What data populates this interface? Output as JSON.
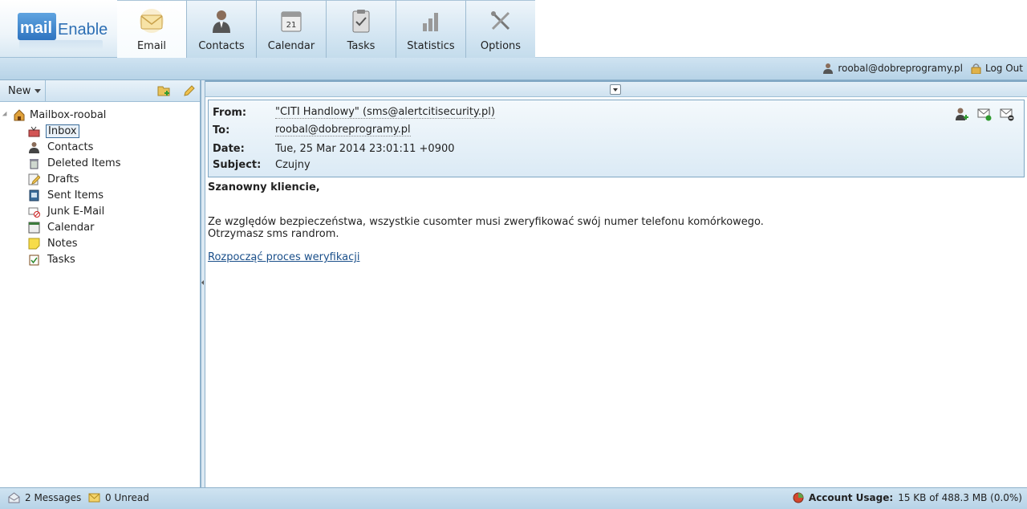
{
  "brand": {
    "logo_mail": "mail",
    "logo_enable": "Enable"
  },
  "tabs": [
    {
      "label": "Email",
      "icon": "envelope-icon",
      "active": true
    },
    {
      "label": "Contacts",
      "icon": "person-icon",
      "active": false
    },
    {
      "label": "Calendar",
      "icon": "calendar-icon",
      "active": false
    },
    {
      "label": "Tasks",
      "icon": "clipboard-icon",
      "active": false
    },
    {
      "label": "Statistics",
      "icon": "bar-chart-icon",
      "active": false
    },
    {
      "label": "Options",
      "icon": "tools-icon",
      "active": false
    }
  ],
  "userbar": {
    "user": "roobal@dobreprogramy.pl",
    "logout": "Log Out"
  },
  "left_toolbar": {
    "new_label": "New"
  },
  "tree": {
    "root": "Mailbox-roobal",
    "folders": [
      {
        "label": "Inbox",
        "icon": "inbox-icon",
        "selected": true
      },
      {
        "label": "Contacts",
        "icon": "contacts-icon",
        "selected": false
      },
      {
        "label": "Deleted Items",
        "icon": "trash-icon",
        "selected": false
      },
      {
        "label": "Drafts",
        "icon": "drafts-icon",
        "selected": false
      },
      {
        "label": "Sent Items",
        "icon": "sent-icon",
        "selected": false
      },
      {
        "label": "Junk E-Mail",
        "icon": "junk-icon",
        "selected": false
      },
      {
        "label": "Calendar",
        "icon": "calendar-icon",
        "selected": false
      },
      {
        "label": "Notes",
        "icon": "notes-icon",
        "selected": false
      },
      {
        "label": "Tasks",
        "icon": "tasks-icon",
        "selected": false
      }
    ]
  },
  "message": {
    "from_label": "From:",
    "from": "\"CITI Handlowy\" (sms@alertcitisecurity.pl)",
    "to_label": "To:",
    "to": "roobal@dobreprogramy.pl",
    "date_label": "Date:",
    "date": "Tue, 25 Mar 2014 23:01:11 +0900",
    "subject_label": "Subject:",
    "subject": "Czujny",
    "greeting": "Szanowny kliencie,",
    "line1": "Ze względów bezpieczeństwa, wszystkie cusomter musi zweryfikować swój numer telefonu komórkowego.",
    "line2": "Otrzymasz sms randrom.",
    "link": "Rozpocząć proces weryfikacji"
  },
  "status": {
    "messages": "2 Messages",
    "unread": "0 Unread",
    "usage_label": "Account Usage:",
    "usage_value": "15 KB of 488.3 MB (0.0%)"
  },
  "colors": {
    "accent": "#2d6fb4",
    "link": "#1a4f8a",
    "bar": "#c4dcec"
  }
}
